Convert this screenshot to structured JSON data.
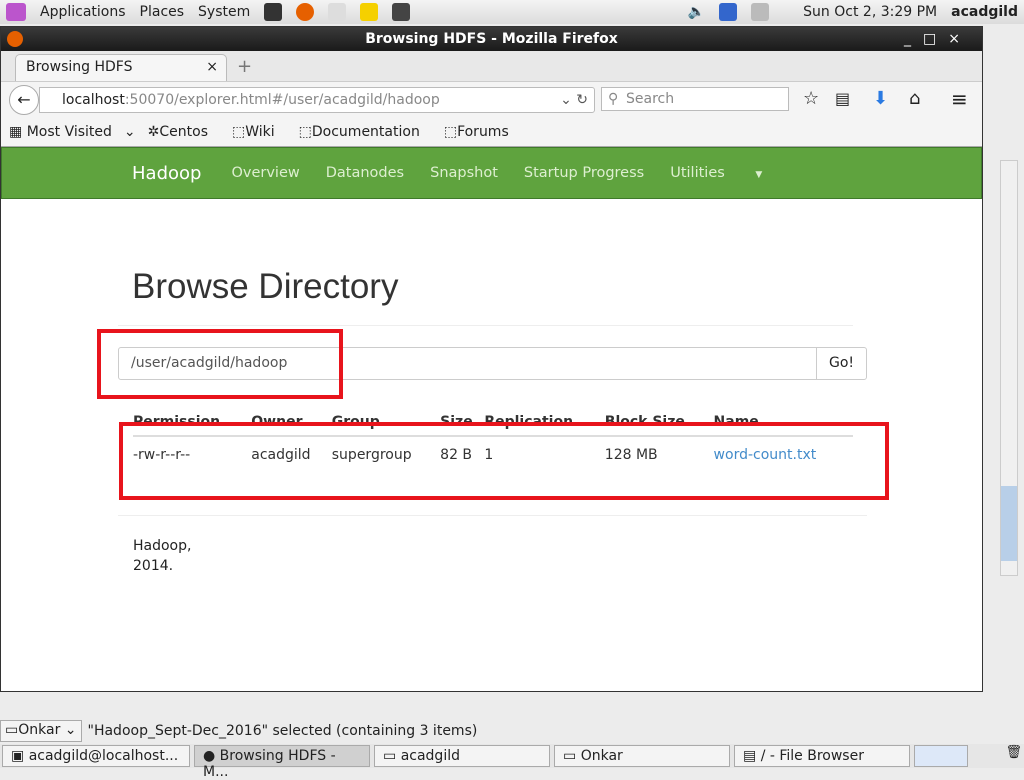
{
  "desktop": {
    "menus": [
      "Applications",
      "Places",
      "System"
    ],
    "clock": "Sun Oct  2,  3:29 PM",
    "user": "acadgild"
  },
  "window": {
    "title": "Browsing HDFS - Mozilla Firefox"
  },
  "browser": {
    "tab": "Browsing HDFS",
    "url_host": "localhost",
    "url_rest": ":50070/explorer.html#/user/acadgild/hadoop",
    "search_placeholder": "Search",
    "bookmarks": [
      "Most Visited",
      "Centos",
      "Wiki",
      "Documentation",
      "Forums"
    ]
  },
  "hadoop": {
    "brand": "Hadoop",
    "nav": [
      "Overview",
      "Datanodes",
      "Snapshot",
      "Startup Progress",
      "Utilities"
    ],
    "title": "Browse Directory",
    "path": "/user/acadgild/hadoop",
    "go": "Go!",
    "columns": [
      "Permission",
      "Owner",
      "Group",
      "Size",
      "Replication",
      "Block Size",
      "Name"
    ],
    "rows": [
      [
        "-rw-r--r--",
        "acadgild",
        "supergroup",
        "82 B",
        "1",
        "128 MB",
        "word-count.txt"
      ]
    ],
    "footer1": "Hadoop,",
    "footer2": "2014."
  },
  "filebrowser": {
    "location": "Onkar",
    "status": "\"Hadoop_Sept-Dec_2016\" selected (containing 3 items)"
  },
  "taskbar": [
    "acadgild@localhost...",
    "Browsing HDFS - M...",
    "acadgild",
    "Onkar",
    "/ - File Browser"
  ],
  "colors": {
    "navbar": "#5fa33e",
    "link": "#428bca",
    "highlight": "#e8141c"
  }
}
